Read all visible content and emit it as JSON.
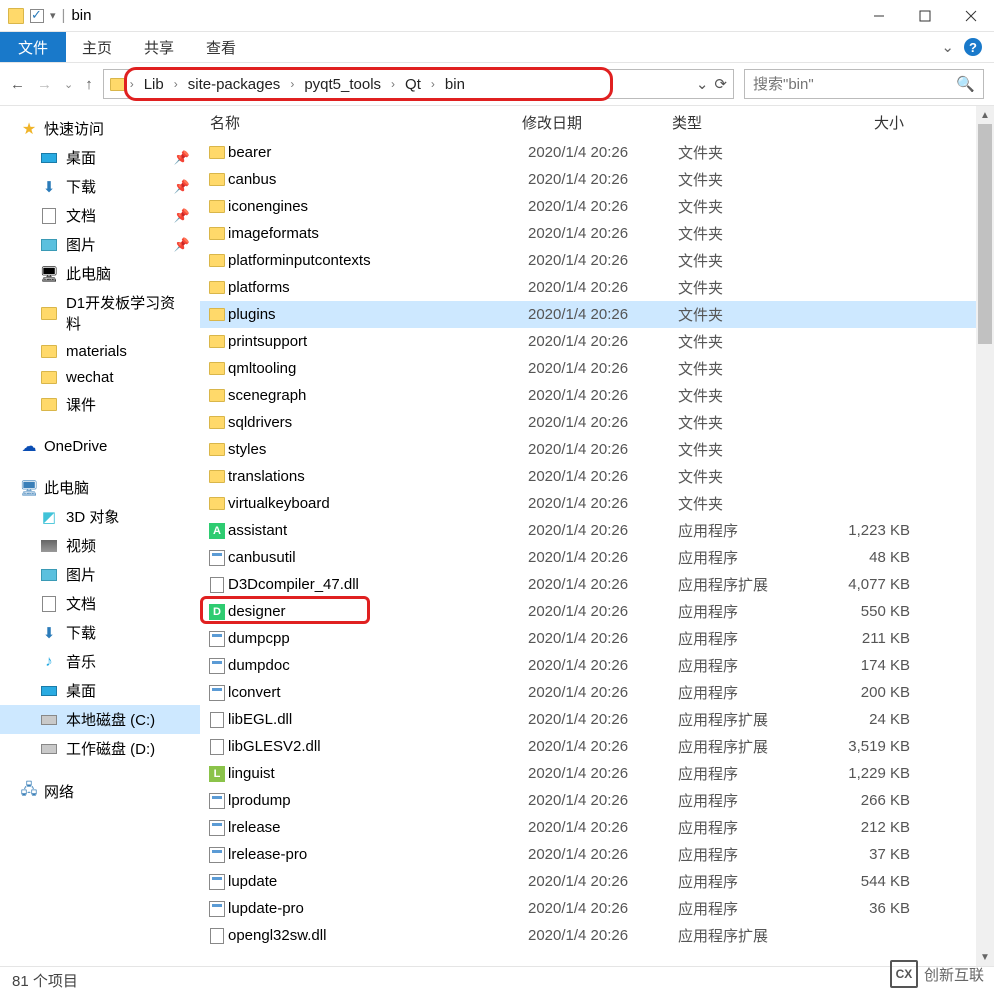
{
  "title": "bin",
  "tabs": {
    "file": "文件",
    "home": "主页",
    "share": "共享",
    "view": "查看"
  },
  "breadcrumb": [
    "Lib",
    "site-packages",
    "pyqt5_tools",
    "Qt",
    "bin"
  ],
  "search_placeholder": "搜索\"bin\"",
  "columns": {
    "name": "名称",
    "date": "修改日期",
    "type": "类型",
    "size": "大小"
  },
  "sidebar": {
    "quick": "快速访问",
    "items1": [
      {
        "label": "桌面",
        "icon": "desk",
        "pin": true
      },
      {
        "label": "下载",
        "icon": "dl",
        "pin": true
      },
      {
        "label": "文档",
        "icon": "doc",
        "pin": true
      },
      {
        "label": "图片",
        "icon": "pic",
        "pin": true
      },
      {
        "label": "此电脑",
        "icon": "pc"
      },
      {
        "label": "D1开发板学习资料",
        "icon": "folder"
      },
      {
        "label": "materials",
        "icon": "folder"
      },
      {
        "label": "wechat",
        "icon": "folder"
      },
      {
        "label": "课件",
        "icon": "folder"
      }
    ],
    "onedrive": "OneDrive",
    "pc": "此电脑",
    "items2": [
      {
        "label": "3D 对象",
        "icon": "3d"
      },
      {
        "label": "视频",
        "icon": "vid"
      },
      {
        "label": "图片",
        "icon": "pic"
      },
      {
        "label": "文档",
        "icon": "doc"
      },
      {
        "label": "下载",
        "icon": "dl"
      },
      {
        "label": "音乐",
        "icon": "music"
      },
      {
        "label": "桌面",
        "icon": "desk"
      },
      {
        "label": "本地磁盘 (C:)",
        "icon": "hdd",
        "sel": true
      },
      {
        "label": "工作磁盘 (D:)",
        "icon": "hdd"
      }
    ],
    "net": "网络"
  },
  "files": [
    {
      "name": "bearer",
      "date": "2020/1/4 20:26",
      "type": "文件夹",
      "size": "",
      "icon": "folder"
    },
    {
      "name": "canbus",
      "date": "2020/1/4 20:26",
      "type": "文件夹",
      "size": "",
      "icon": "folder"
    },
    {
      "name": "iconengines",
      "date": "2020/1/4 20:26",
      "type": "文件夹",
      "size": "",
      "icon": "folder"
    },
    {
      "name": "imageformats",
      "date": "2020/1/4 20:26",
      "type": "文件夹",
      "size": "",
      "icon": "folder"
    },
    {
      "name": "platforminputcontexts",
      "date": "2020/1/4 20:26",
      "type": "文件夹",
      "size": "",
      "icon": "folder"
    },
    {
      "name": "platforms",
      "date": "2020/1/4 20:26",
      "type": "文件夹",
      "size": "",
      "icon": "folder"
    },
    {
      "name": "plugins",
      "date": "2020/1/4 20:26",
      "type": "文件夹",
      "size": "",
      "icon": "folder",
      "sel": true
    },
    {
      "name": "printsupport",
      "date": "2020/1/4 20:26",
      "type": "文件夹",
      "size": "",
      "icon": "folder"
    },
    {
      "name": "qmltooling",
      "date": "2020/1/4 20:26",
      "type": "文件夹",
      "size": "",
      "icon": "folder"
    },
    {
      "name": "scenegraph",
      "date": "2020/1/4 20:26",
      "type": "文件夹",
      "size": "",
      "icon": "folder"
    },
    {
      "name": "sqldrivers",
      "date": "2020/1/4 20:26",
      "type": "文件夹",
      "size": "",
      "icon": "folder"
    },
    {
      "name": "styles",
      "date": "2020/1/4 20:26",
      "type": "文件夹",
      "size": "",
      "icon": "folder"
    },
    {
      "name": "translations",
      "date": "2020/1/4 20:26",
      "type": "文件夹",
      "size": "",
      "icon": "folder"
    },
    {
      "name": "virtualkeyboard",
      "date": "2020/1/4 20:26",
      "type": "文件夹",
      "size": "",
      "icon": "folder"
    },
    {
      "name": "assistant",
      "date": "2020/1/4 20:26",
      "type": "应用程序",
      "size": "1,223 KB",
      "icon": "A"
    },
    {
      "name": "canbusutil",
      "date": "2020/1/4 20:26",
      "type": "应用程序",
      "size": "48 KB",
      "icon": "exe"
    },
    {
      "name": "D3Dcompiler_47.dll",
      "date": "2020/1/4 20:26",
      "type": "应用程序扩展",
      "size": "4,077 KB",
      "icon": "doc"
    },
    {
      "name": "designer",
      "date": "2020/1/4 20:26",
      "type": "应用程序",
      "size": "550 KB",
      "icon": "D",
      "hl": true
    },
    {
      "name": "dumpcpp",
      "date": "2020/1/4 20:26",
      "type": "应用程序",
      "size": "211 KB",
      "icon": "exe"
    },
    {
      "name": "dumpdoc",
      "date": "2020/1/4 20:26",
      "type": "应用程序",
      "size": "174 KB",
      "icon": "exe"
    },
    {
      "name": "lconvert",
      "date": "2020/1/4 20:26",
      "type": "应用程序",
      "size": "200 KB",
      "icon": "exe"
    },
    {
      "name": "libEGL.dll",
      "date": "2020/1/4 20:26",
      "type": "应用程序扩展",
      "size": "24 KB",
      "icon": "doc"
    },
    {
      "name": "libGLESV2.dll",
      "date": "2020/1/4 20:26",
      "type": "应用程序扩展",
      "size": "3,519 KB",
      "icon": "doc"
    },
    {
      "name": "linguist",
      "date": "2020/1/4 20:26",
      "type": "应用程序",
      "size": "1,229 KB",
      "icon": "L"
    },
    {
      "name": "lprodump",
      "date": "2020/1/4 20:26",
      "type": "应用程序",
      "size": "266 KB",
      "icon": "exe"
    },
    {
      "name": "lrelease",
      "date": "2020/1/4 20:26",
      "type": "应用程序",
      "size": "212 KB",
      "icon": "exe"
    },
    {
      "name": "lrelease-pro",
      "date": "2020/1/4 20:26",
      "type": "应用程序",
      "size": "37 KB",
      "icon": "exe"
    },
    {
      "name": "lupdate",
      "date": "2020/1/4 20:26",
      "type": "应用程序",
      "size": "544 KB",
      "icon": "exe"
    },
    {
      "name": "lupdate-pro",
      "date": "2020/1/4 20:26",
      "type": "应用程序",
      "size": "36 KB",
      "icon": "exe"
    },
    {
      "name": "opengl32sw.dll",
      "date": "2020/1/4 20:26",
      "type": "应用程序扩展",
      "size": "",
      "icon": "doc"
    }
  ],
  "status": "81 个项目",
  "watermark": "创新互联"
}
